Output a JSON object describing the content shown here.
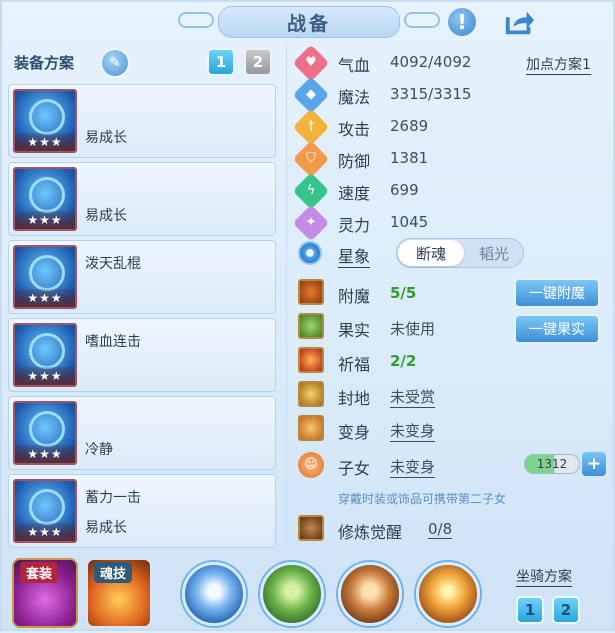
{
  "header": {
    "title": "战备"
  },
  "equipment": {
    "label": "装备方案",
    "plan_tabs": [
      "1",
      "2"
    ],
    "items": [
      {
        "skill": "",
        "owner": "易成长"
      },
      {
        "skill": "",
        "owner": "易成长"
      },
      {
        "skill": "泼天乱棍",
        "owner": ""
      },
      {
        "skill": "嗜血连击",
        "owner": ""
      },
      {
        "skill": "",
        "owner": "冷静"
      },
      {
        "skill": "蓄力一击",
        "owner": "易成长"
      }
    ],
    "stars": "★★★"
  },
  "stats": {
    "add_point_plan": "加点方案1",
    "rows": [
      {
        "name": "气血",
        "value": "4092/4092",
        "icon": "heart-icon",
        "color": "#ef6f8a"
      },
      {
        "name": "魔法",
        "value": "3315/3315",
        "icon": "mana-icon",
        "color": "#5aa6ea"
      },
      {
        "name": "攻击",
        "value": "2689",
        "icon": "sword-icon",
        "color": "#f3b23a"
      },
      {
        "name": "防御",
        "value": "1381",
        "icon": "shield-icon",
        "color": "#f39a4a"
      },
      {
        "name": "速度",
        "value": "699",
        "icon": "speed-icon",
        "color": "#35c58a"
      },
      {
        "name": "灵力",
        "value": "1045",
        "icon": "spirit-icon",
        "color": "#c58be6"
      }
    ]
  },
  "constellation": {
    "name": "星象",
    "options": [
      "断魂",
      "韬光"
    ],
    "selected": "断魂"
  },
  "buffs": {
    "rows": [
      {
        "name": "附魔",
        "value": "5/5",
        "style": "green"
      },
      {
        "name": "果实",
        "value": "未使用",
        "style": "plain"
      },
      {
        "name": "祈福",
        "value": "2/2",
        "style": "green"
      },
      {
        "name": "封地",
        "value": "未受赏",
        "style": "ul"
      },
      {
        "name": "变身",
        "value": "未变身",
        "style": "ul"
      }
    ],
    "enchant_button": "一键附魔",
    "fruit_button": "一键果实"
  },
  "child": {
    "name": "子女",
    "value": "未变身",
    "count": "1312",
    "plus": "+",
    "hint": "穿戴时装或饰品可携带第二子女"
  },
  "cultivation": {
    "name": "修炼觉醒",
    "value": "0/8"
  },
  "bottom": {
    "set_tab": "套装",
    "soul_tab": "魂技",
    "mount_label": "坐骑方案",
    "mount_tabs": [
      "1",
      "2"
    ]
  }
}
